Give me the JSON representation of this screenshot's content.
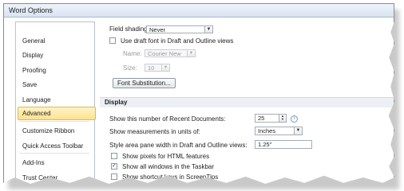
{
  "window": {
    "title": "Word Options"
  },
  "sidebar": {
    "items": [
      {
        "label": "General"
      },
      {
        "label": "Display"
      },
      {
        "label": "Proofing"
      },
      {
        "label": "Save"
      },
      {
        "label": "Language"
      },
      {
        "label": "Advanced",
        "selected": true
      },
      {
        "label": "Customize Ribbon"
      },
      {
        "label": "Quick Access Toolbar"
      },
      {
        "label": "Add-Ins"
      },
      {
        "label": "Trust Center"
      }
    ]
  },
  "document_content": {
    "field_shading_label": "Field shading:",
    "field_shading_value": "Never",
    "draft_font_label": "Use draft font in Draft and Outline views",
    "draft_font_checked": false,
    "name_label": "Name:",
    "name_value": "Courier New",
    "size_label": "Size:",
    "size_value": "10",
    "font_substitution_button": "Font Substitution..."
  },
  "display": {
    "section_title": "Display",
    "recent_docs_label": "Show this number of Recent Documents:",
    "recent_docs_value": "25",
    "info_glyph": "i",
    "measurement_label": "Show measurements in units of:",
    "measurement_value": "Inches",
    "style_area_label": "Style area pane width in Draft and Outline views:",
    "style_area_value": "1.25\"",
    "pixels_label": "Show pixels for HTML features",
    "pixels_checked": false,
    "taskbar_label": "Show all windows in the Taskbar",
    "taskbar_checked": true,
    "shortcut_keys_label": "Show shortcut keys in ScreenTips"
  },
  "icons": {
    "dropdown_arrow": "▼",
    "spin_up": "▲",
    "spin_down": "▼",
    "check": "✓"
  }
}
